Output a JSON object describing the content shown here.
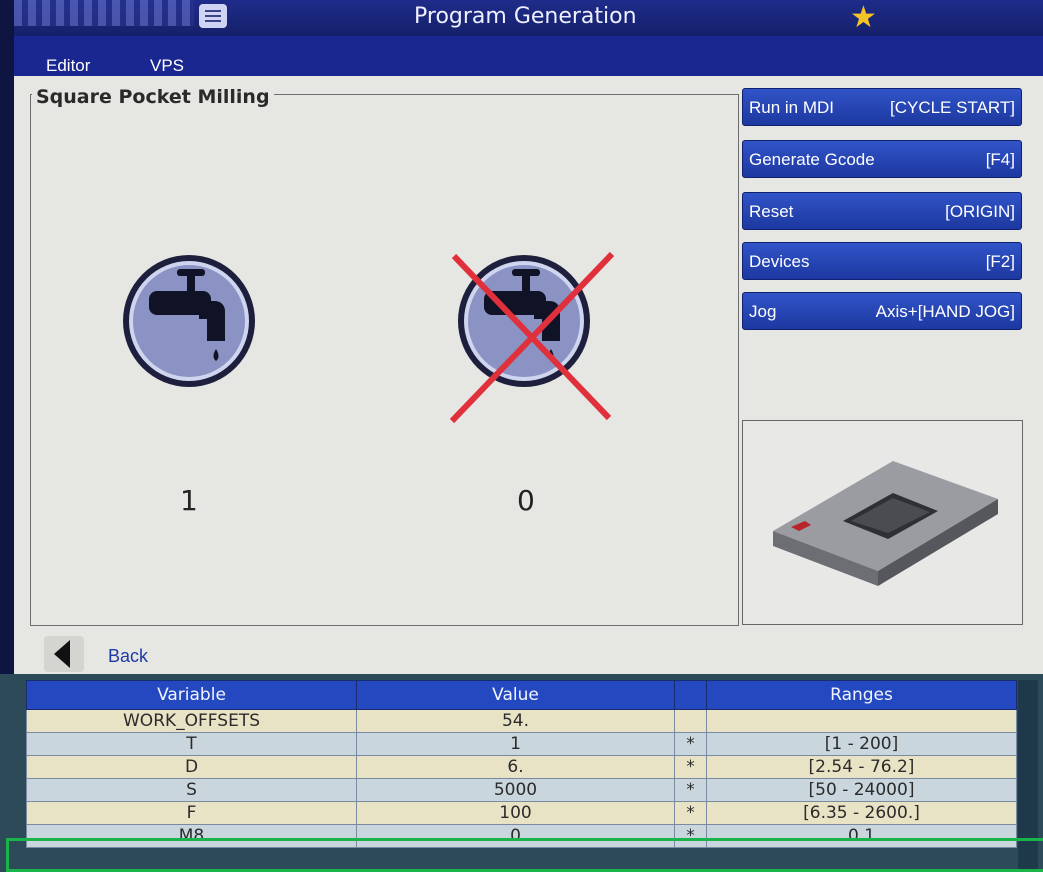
{
  "header": {
    "title": "Program Generation",
    "menu_icon": "hamburger-menu-icon",
    "favorite_icon": "star-icon"
  },
  "tabs": [
    {
      "label": "Editor"
    },
    {
      "label": "VPS"
    }
  ],
  "panel": {
    "title": "Square Pocket Milling",
    "options": [
      {
        "icon": "coolant-on-icon",
        "value": "1"
      },
      {
        "icon": "coolant-off-icon",
        "value": "0"
      }
    ]
  },
  "actions": [
    {
      "label": "Run in MDI",
      "key": "[CYCLE START]"
    },
    {
      "label": "Generate Gcode",
      "key": "[F4]"
    },
    {
      "label": "Reset",
      "key": "[ORIGIN]"
    },
    {
      "label": "Devices",
      "key": "[F2]"
    },
    {
      "label": "Jog",
      "key": "Axis+[HAND JOG]"
    }
  ],
  "back": {
    "label": "Back"
  },
  "table": {
    "headers": {
      "variable": "Variable",
      "value": "Value",
      "flag": "",
      "ranges": "Ranges"
    },
    "rows": [
      {
        "variable": "WORK_OFFSETS",
        "value": "54.",
        "flag": "",
        "ranges": ""
      },
      {
        "variable": "T",
        "value": "1",
        "flag": "*",
        "ranges": "[1 - 200]"
      },
      {
        "variable": "D",
        "value": "6.",
        "flag": "*",
        "ranges": "[2.54 - 76.2]"
      },
      {
        "variable": "S",
        "value": "5000",
        "flag": "*",
        "ranges": "[50 - 24000]"
      },
      {
        "variable": "F",
        "value": "100",
        "flag": "*",
        "ranges": "[6.35 - 2600.]"
      },
      {
        "variable": "M8",
        "value": "0",
        "flag": "*",
        "ranges": "0 1"
      }
    ]
  },
  "colors": {
    "accent_blue": "#1d38a0",
    "highlight_green": "#19b44a",
    "cross_red": "#e0303c",
    "star_yellow": "#f4c327"
  }
}
